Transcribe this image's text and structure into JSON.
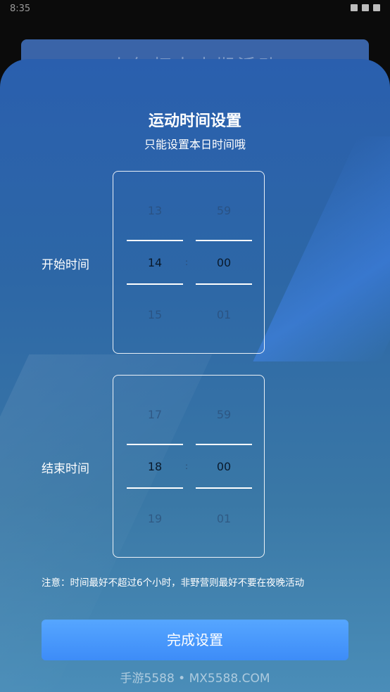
{
  "status_bar": {
    "time": "8:35"
  },
  "background_card": {
    "text": "上午打卡本期活动"
  },
  "sheet": {
    "title": "运动时间设置",
    "subtitle": "只能设置本日时间哦",
    "start": {
      "label": "开始时间",
      "hour": {
        "prev": "13",
        "current": "14",
        "next": "15"
      },
      "minute": {
        "prev": "59",
        "current": "00",
        "next": "01"
      },
      "separator": ":"
    },
    "end": {
      "label": "结束时间",
      "hour": {
        "prev": "17",
        "current": "18",
        "next": "19"
      },
      "minute": {
        "prev": "59",
        "current": "00",
        "next": "01"
      },
      "separator": ":"
    },
    "note": "注意：时间最好不超过6个小时，非野营则最好不要在夜晚活动",
    "done_label": "完成设置"
  },
  "watermark": "手游5588 • MX5588.COM"
}
